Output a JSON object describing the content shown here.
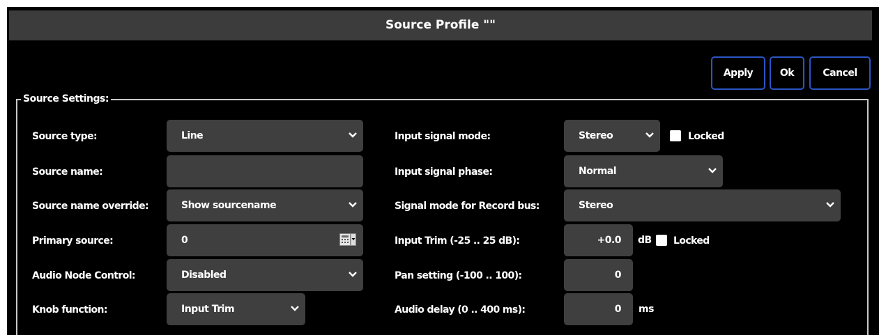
{
  "window": {
    "title": "Source Profile \"\""
  },
  "buttons": {
    "apply": "Apply",
    "ok": "Ok",
    "cancel": "Cancel"
  },
  "section": {
    "legend": "Source Settings:"
  },
  "left": {
    "source_type": {
      "label": "Source type:",
      "value": "Line"
    },
    "source_name": {
      "label": "Source name:",
      "value": ""
    },
    "name_override": {
      "label": "Source name override:",
      "value": "Show sourcename"
    },
    "primary_source": {
      "label": "Primary source:",
      "value": "0",
      "icon": "calculator-icon"
    },
    "audio_node": {
      "label": "Audio Node Control:",
      "value": "Disabled"
    },
    "knob_function": {
      "label": "Knob function:",
      "value": "Input Trim"
    }
  },
  "right": {
    "input_mode": {
      "label": "Input signal mode:",
      "value": "Stereo",
      "locked_label": "Locked",
      "locked": false
    },
    "input_phase": {
      "label": "Input signal phase:",
      "value": "Normal"
    },
    "record_bus": {
      "label": "Signal mode for Record bus:",
      "value": "Stereo"
    },
    "input_trim": {
      "label": "Input Trim (-25 .. 25 dB):",
      "value": "+0.0",
      "unit": "dB",
      "locked_label": "Locked",
      "locked": false
    },
    "pan": {
      "label": "Pan setting (-100 .. 100):",
      "value": "0"
    },
    "delay": {
      "label": "Audio delay (0 .. 400 ms):",
      "value": "0",
      "unit": "ms"
    }
  },
  "colors": {
    "background": "#000000",
    "titlebar": "#3c3c3c",
    "field": "#3f3f3f",
    "button_border": "#2b55c4",
    "fieldset_border": "#c8c8c8"
  }
}
